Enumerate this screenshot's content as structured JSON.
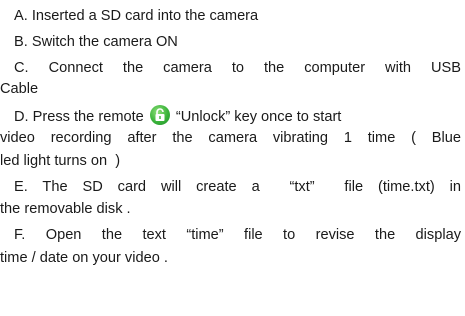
{
  "steps": {
    "a": "A.   Inserted a SD card into the camera",
    "b": "B.   Switch the camera ON",
    "c1": "C.   Connect the camera to the computer with USB",
    "c2": "Cable",
    "d1_pre": "D.   Press the remote",
    "d1_post": "“Unlock” key once to start",
    "d2": "video recording after the camera vibrating 1 time ( Blue",
    "d3": "led light turns on  )",
    "e1": "E.   The SD card will create a  “txt”  file (time.txt) in",
    "e2": "the removable disk .",
    "f1": "F.   Open the text “time” file to revise the display",
    "f2": "time / date on your video ."
  },
  "icons": {
    "unlock": "unlock-key-icon"
  },
  "colors": {
    "icon_green": "#3ab33a",
    "text": "#1a1a1a"
  }
}
